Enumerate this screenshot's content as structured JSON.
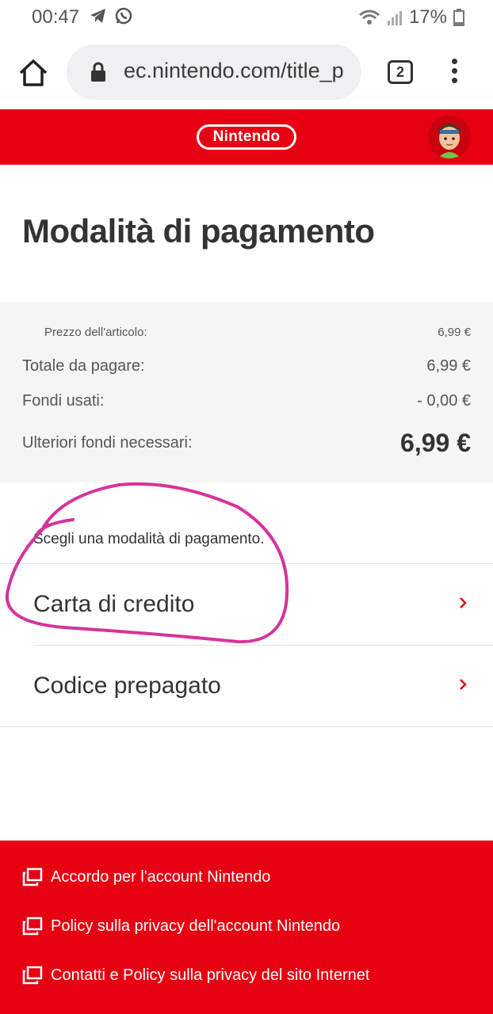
{
  "status_bar": {
    "time": "00:47",
    "battery": "17%",
    "icons": [
      "telegram-icon",
      "whatsapp-icon",
      "wifi-icon",
      "signal-icon",
      "battery-icon"
    ]
  },
  "browser": {
    "url": "ec.nintendo.com/title_p",
    "tab_count": "2"
  },
  "header": {
    "logo_text": "Nintendo",
    "brand_color": "#e60012"
  },
  "page": {
    "title": "Modalità di pagamento"
  },
  "summary": {
    "item_price_label": "Prezzo dell'articolo:",
    "item_price_value": "6,99 €",
    "total_label": "Totale da pagare:",
    "total_value": "6,99 €",
    "funds_label": "Fondi usati:",
    "funds_value": "- 0,00 €",
    "needed_label": "Ulteriori fondi necessari:",
    "needed_value": "6,99 €"
  },
  "payment": {
    "prompt": "Scegli una modalità di pagamento.",
    "options": [
      {
        "label": "Carta di credito"
      },
      {
        "label": "Codice prepagato"
      }
    ]
  },
  "footer": {
    "links": [
      {
        "label": "Accordo per l'account Nintendo"
      },
      {
        "label": "Policy sulla privacy dell'account Nintendo"
      },
      {
        "label": "Contatti e Policy sulla privacy del sito Internet"
      }
    ]
  }
}
